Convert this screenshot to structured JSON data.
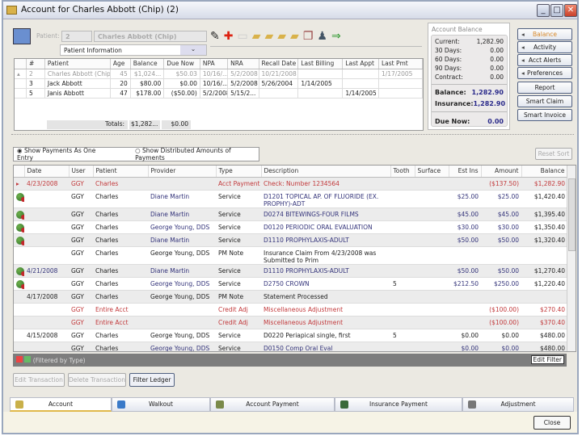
{
  "window": {
    "title": "Account for Charles Abbott (Chip) (2)"
  },
  "patient": {
    "label": "Patient:",
    "id": "2",
    "name": "Charles Abbott (Chip)",
    "view_select": "Patient Information"
  },
  "patient_grid": {
    "columns": [
      "#",
      "Patient",
      "Age",
      "Balance",
      "Due Now",
      "NPA",
      "NRA",
      "Recall Date",
      "Last Billing",
      "Last Appt",
      "Last Pmt"
    ],
    "rows": [
      [
        "2",
        "Charles Abbott (Chip)",
        "45",
        "$1,024...",
        "$50.03",
        "10/16/...",
        "5/2/2008",
        "10/21/2008",
        "",
        "",
        "1/17/2005"
      ],
      [
        "3",
        "Jack Abbott",
        "20",
        "$80.00",
        "$0.00",
        "10/16/...",
        "5/2/2008",
        "5/26/2004",
        "1/14/2005",
        "",
        ""
      ],
      [
        "5",
        "Janis Abbott",
        "47",
        "$178.00",
        "($50.00)",
        "5/2/2008",
        "5/15/2...",
        "",
        "",
        "1/14/2005",
        ""
      ]
    ],
    "totals_label": "Totals:",
    "totals_balance": "$1,282...",
    "totals_due": "$0.00"
  },
  "account_balance": {
    "title": "Account Balance",
    "lines": [
      {
        "label": "Current:",
        "value": "1,282.90"
      },
      {
        "label": "30 Days:",
        "value": "0.00"
      },
      {
        "label": "60 Days:",
        "value": "0.00"
      },
      {
        "label": "90 Days:",
        "value": "0.00"
      },
      {
        "label": "Contract:",
        "value": "0.00"
      }
    ],
    "balance_label": "Balance:",
    "balance": "1,282.90",
    "insurance_label": "Insurance:",
    "insurance": "1,282.90",
    "due_label": "Due Now:",
    "due": "0.00"
  },
  "side_buttons": [
    "Balance",
    "Activity",
    "Acct Alerts",
    "Preferences",
    "Report",
    "Smart Claim",
    "Smart Invoice"
  ],
  "ledger": {
    "radio1": "Show Payments As One Entry",
    "radio2": "Show Distributed Amounts of Payments",
    "reset_sort": "Reset Sort",
    "columns": [
      "Date",
      "User",
      "Patient",
      "Provider",
      "Type",
      "Description",
      "Tooth",
      "Surface",
      "Est Ins",
      "Amount",
      "Balance"
    ],
    "rows": [
      {
        "kind": "payment",
        "icon": "",
        "cells": [
          "4/23/2008",
          "GGY",
          "Charles",
          "",
          "Acct Payment",
          "Check: Number 1234564",
          "",
          "",
          "",
          "($137.50)",
          "$1,282.90"
        ]
      },
      {
        "kind": "service",
        "icon": "proc",
        "cells": [
          "",
          "GGY",
          "Charles",
          "Diane Martin",
          "Service",
          "D1201 TOPICAL AP. OF FLUORIDE (EX. PROPHY)-ADT",
          "",
          "",
          "$25.00",
          "$25.00",
          "$1,420.40"
        ]
      },
      {
        "kind": "service",
        "icon": "proc",
        "cells": [
          "",
          "GGY",
          "Charles",
          "Diane Martin",
          "Service",
          "D0274 BITEWINGS-FOUR FILMS",
          "",
          "",
          "$45.00",
          "$45.00",
          "$1,395.40"
        ]
      },
      {
        "kind": "service",
        "icon": "proc",
        "cells": [
          "",
          "GGY",
          "Charles",
          "George Young, DDS",
          "Service",
          "D0120 PERIODIC ORAL EVALUATION",
          "",
          "",
          "$30.00",
          "$30.00",
          "$1,350.40"
        ]
      },
      {
        "kind": "service",
        "icon": "proc",
        "cells": [
          "",
          "GGY",
          "Charles",
          "Diane Martin",
          "Service",
          "D1110 PROPHYLAXIS-ADULT",
          "",
          "",
          "$50.00",
          "$50.00",
          "$1,320.40"
        ]
      },
      {
        "kind": "note",
        "icon": "",
        "cells": [
          "",
          "GGY",
          "Charles",
          "George Young, DDS",
          "PM Note",
          "Insurance Claim From 4/23/2008 was Submitted to Prim",
          "",
          "",
          "",
          "",
          ""
        ]
      },
      {
        "kind": "service",
        "icon": "proc",
        "cells": [
          "4/21/2008",
          "GGY",
          "Charles",
          "Diane Martin",
          "Service",
          "D1110 PROPHYLAXIS-ADULT",
          "",
          "",
          "$50.00",
          "$50.00",
          "$1,270.40"
        ]
      },
      {
        "kind": "service",
        "icon": "proc",
        "cells": [
          "",
          "GGY",
          "Charles",
          "George Young, DDS",
          "Service",
          "D2750 CROWN",
          "5",
          "",
          "$212.50",
          "$250.00",
          "$1,220.40"
        ]
      },
      {
        "kind": "note",
        "icon": "",
        "cells": [
          "4/17/2008",
          "GGY",
          "Charles",
          "George Young, DDS",
          "PM Note",
          "Statement Processed",
          "",
          "",
          "",
          "",
          ""
        ]
      },
      {
        "kind": "payment",
        "icon": "",
        "cells": [
          "",
          "GGY",
          "Entire Acct",
          "",
          "Credit Adj",
          "Miscellaneous Adjustment",
          "",
          "",
          "",
          "($100.00)",
          "$270.40"
        ]
      },
      {
        "kind": "payment",
        "icon": "",
        "cells": [
          "",
          "GGY",
          "Entire Acct",
          "",
          "Credit Adj",
          "Miscellaneous Adjustment",
          "",
          "",
          "",
          "($100.00)",
          "$370.40"
        ]
      },
      {
        "kind": "note",
        "icon": "",
        "cells": [
          "4/15/2008",
          "GGY",
          "Charles",
          "George Young, DDS",
          "Service",
          "D0220 Periapical single, first",
          "5",
          "",
          "$0.00",
          "$0.00",
          "$480.00"
        ]
      },
      {
        "kind": "service",
        "icon": "",
        "cells": [
          "",
          "GGY",
          "Charles",
          "George Young, DDS",
          "Service",
          "D0150 Comp Oral Eval",
          "",
          "",
          "$0.00",
          "$0.00",
          "$480.00"
        ]
      }
    ],
    "filter_text": "(Filtered by Type)",
    "edit_filter": "Edit Filter"
  },
  "actions": {
    "edit": "Edit Transaction",
    "delete": "Delete Transaction",
    "filter": "Filter Ledger"
  },
  "tabs": [
    "Account",
    "Walkout",
    "Account Payment",
    "Insurance Payment",
    "Adjustment"
  ],
  "close": "Close"
}
